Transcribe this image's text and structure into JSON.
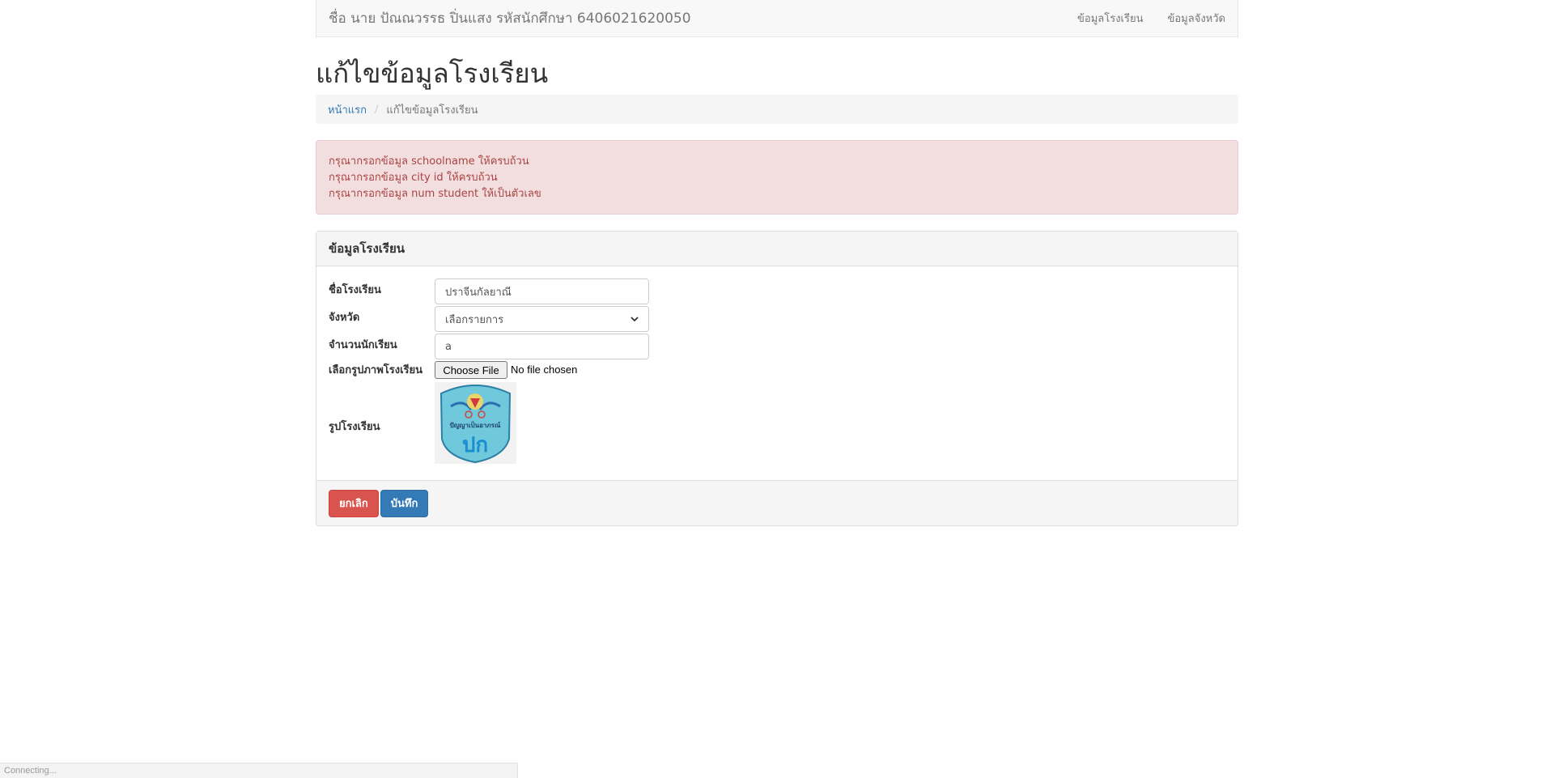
{
  "navbar": {
    "brand": "ชื่อ นาย ปัณณวรรธ ปิ่นแสง รหัสนักศึกษา 6406021620050",
    "links": [
      "ข้อมูลโรงเรียน",
      "ข้อมูลจังหวัด"
    ]
  },
  "page": {
    "title": "แก้ไขข้อมูลโรงเรียน"
  },
  "breadcrumb": {
    "home": "หน้าแรก",
    "separator": "/",
    "current": "แก้ไขข้อมูลโรงเรียน"
  },
  "alert": {
    "messages": [
      "กรุณากรอกข้อมูล schoolname ให้ครบถ้วน",
      "กรุณากรอกข้อมูล city id ให้ครบถ้วน",
      "กรุณากรอกข้อมูล num student ให้เป็นตัวเลข"
    ]
  },
  "panel": {
    "heading": "ข้อมูลโรงเรียน",
    "fields": {
      "school_name_label": "ชื่อโรงเรียน",
      "school_name_value": "ปราจีนกัลยาณี",
      "province_label": "จังหวัด",
      "province_value": "เลือกรายการ",
      "num_students_label": "จำนวนนักเรียน",
      "num_students_value": "a",
      "image_label": "เลือกรูปภาพโรงเรียน",
      "file_button": "Choose File",
      "file_status": "No file chosen",
      "current_image_label": "รูปโรงเรียน"
    },
    "logo_text": "ปัญญาเป็นอาภรณ์",
    "logo_letters": "ปก",
    "buttons": {
      "cancel": "ยกเลิก",
      "save": "บันทึก"
    }
  },
  "status_bar": {
    "text": "Connecting..."
  },
  "colors": {
    "primary": "#337ab7",
    "danger": "#d9534f",
    "alert_bg": "#f2dede",
    "alert_text": "#a94442"
  }
}
